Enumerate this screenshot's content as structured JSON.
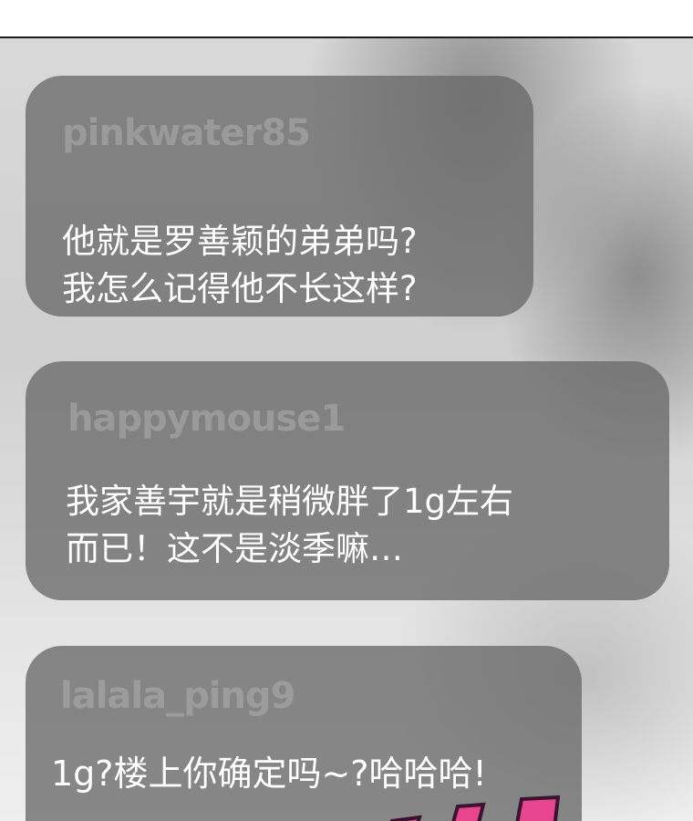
{
  "comments": [
    {
      "username": "pinkwater85",
      "lines": [
        "他就是罗善颖的弟弟吗?",
        "我怎么记得他不长这样?"
      ]
    },
    {
      "username": "happymouse1",
      "lines": [
        "我家善宇就是稍微胖了1g左右",
        "而已！这不是淡季嘛…"
      ]
    },
    {
      "username": "lalala_ping9",
      "lines": [
        "1g?楼上你确定吗~?哈哈哈!"
      ]
    }
  ],
  "colors": {
    "bubble": "#696969",
    "text": "#ffffff",
    "sfx_fill": "#e8458f",
    "sfx_stroke": "#3a1330"
  }
}
